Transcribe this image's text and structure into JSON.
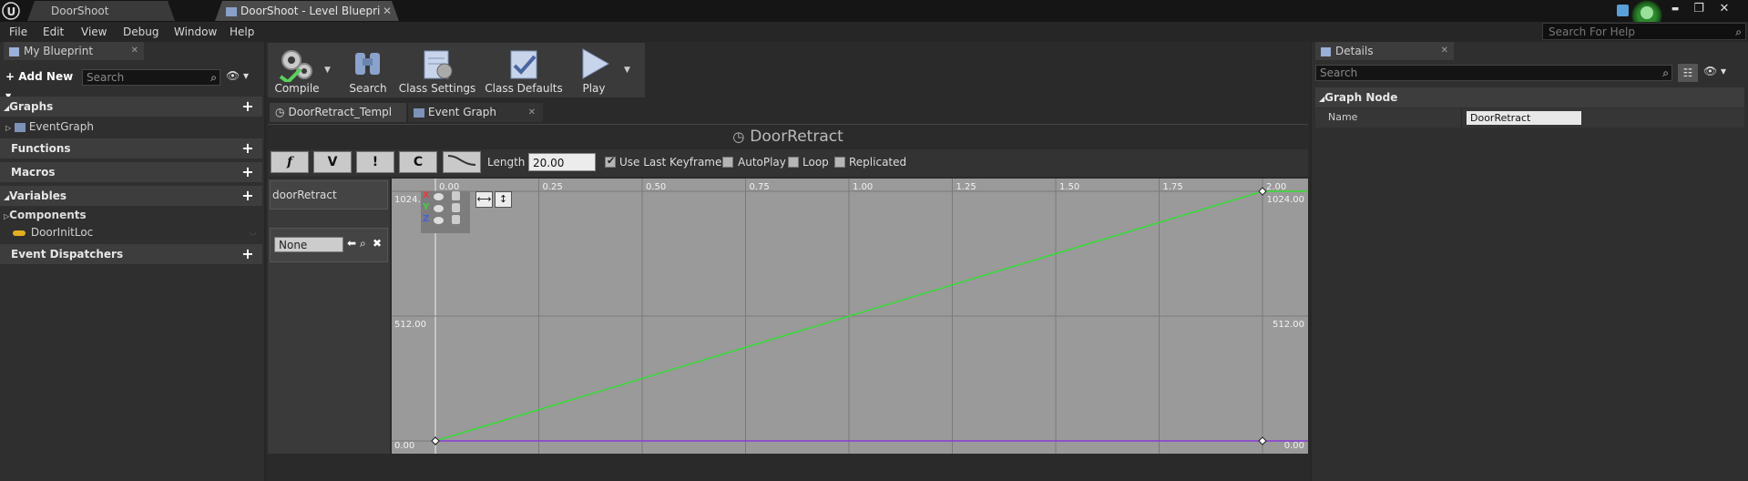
{
  "window": {
    "doc_tabs": [
      "DoorShoot",
      "DoorShoot - Level Bluepri"
    ],
    "minimize": "▬",
    "restore": "❐",
    "close": "✕"
  },
  "menu": {
    "items": [
      "File",
      "Edit",
      "View",
      "Debug",
      "Window",
      "Help"
    ],
    "search_help_placeholder": "Search For Help"
  },
  "my_blueprint": {
    "tab_title": "My Blueprint",
    "add_new": "Add New",
    "search_placeholder": "Search",
    "sections": {
      "graphs": "Graphs",
      "event_graph": "EventGraph",
      "functions": "Functions",
      "macros": "Macros",
      "variables": "Variables",
      "components": "Components",
      "door_init_loc": "DoorInitLoc",
      "event_dispatchers": "Event Dispatchers"
    }
  },
  "toolbar": {
    "compile": "Compile",
    "search": "Search",
    "class_settings": "Class Settings",
    "class_defaults": "Class Defaults",
    "play": "Play"
  },
  "editor_tabs": [
    "DoorRetract_Templ",
    "Event Graph"
  ],
  "timeline": {
    "title": "DoorRetract",
    "length_label": "Length",
    "length_value": "20.00",
    "use_last_keyframe": "Use Last Keyframe?",
    "autoplay": "AutoPlay",
    "loop": "Loop",
    "replicated": "Replicated",
    "track_name": "doorRetract",
    "curve_asset": "None",
    "key_buttons": [
      "f",
      "V",
      "!",
      "C"
    ]
  },
  "chart_data": {
    "type": "line",
    "x_ticks": [
      "0.00",
      "0.25",
      "0.50",
      "0.75",
      "1.00",
      "1.25",
      "1.50",
      "1.75",
      "2.00"
    ],
    "y_ticks": [
      "0.00",
      "512.00",
      "1024.00"
    ],
    "xlim": [
      0,
      2.0
    ],
    "ylim": [
      0,
      1024
    ],
    "series": [
      {
        "color": "#33dd33",
        "x": [
          0,
          2.0
        ],
        "y": [
          0,
          1024
        ]
      },
      {
        "color": "#8a3ad8",
        "x": [
          0,
          2.0
        ],
        "y": [
          0,
          0
        ]
      }
    ],
    "axis_markers": [
      "X",
      "Y",
      "Z"
    ]
  },
  "details": {
    "tab_title": "Details",
    "search_placeholder": "Search",
    "section": "Graph Node",
    "name_label": "Name",
    "name_value": "DoorRetract"
  },
  "colors": {
    "accent": "#33dd33",
    "panel": "#2f2f2f",
    "graph_bg": "#9a9a9a"
  }
}
